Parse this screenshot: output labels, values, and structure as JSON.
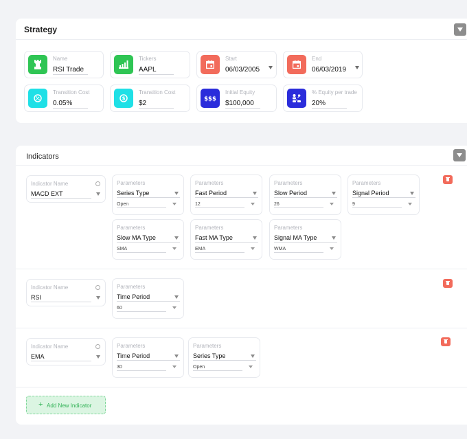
{
  "strategy": {
    "title": "Strategy",
    "cards": [
      {
        "label": "Name",
        "value": "RSI Trade",
        "icon": "rook-icon",
        "color": "#2fc554"
      },
      {
        "label": "Tickers",
        "value": "AAPL",
        "icon": "bar-chart-icon",
        "color": "#2fc554"
      },
      {
        "label": "Start",
        "value": "06/03/2005",
        "icon": "calendar-icon",
        "color": "#f26b5b"
      },
      {
        "label": "End",
        "value": "06/03/2019",
        "icon": "calendar-icon",
        "color": "#f26b5b"
      },
      {
        "label": "Transition Cost",
        "value": "0.05%",
        "icon": "percent-coin-icon",
        "color": "#1fe0e6"
      },
      {
        "label": "Transition Cost",
        "value": "$2",
        "icon": "dollar-coin-icon",
        "color": "#1fe0e6"
      },
      {
        "label": "Initial Equity",
        "value": "$100,000",
        "icon": "dollar-sign-icon",
        "color": "#2b2ddb"
      },
      {
        "label": "% Equity per trade",
        "value": "20%",
        "icon": "equity-split-icon",
        "color": "#2b2ddb"
      }
    ]
  },
  "indicators": {
    "title": "Indicators",
    "name_label": "Indicator Name",
    "parameters_label": "Parameters",
    "rows": [
      {
        "name": "MACD EXT",
        "params": [
          {
            "label": "Series Type",
            "value": "Open"
          },
          {
            "label": "Fast Period",
            "value": "12"
          },
          {
            "label": "Slow Period",
            "value": "26"
          },
          {
            "label": "Signal  Period",
            "value": "9"
          },
          {
            "label": "Slow MA Type",
            "value": "SMA"
          },
          {
            "label": "Fast MA Type",
            "value": "EMA"
          },
          {
            "label": "Signal MA Type",
            "value": "WMA"
          }
        ]
      },
      {
        "name": "RSI",
        "params": [
          {
            "label": "Time Period",
            "value": "60"
          }
        ]
      },
      {
        "name": "EMA",
        "params": [
          {
            "label": "Time Period",
            "value": "30"
          },
          {
            "label": "Series Type",
            "value": "Open"
          }
        ]
      }
    ],
    "add_label": "Add New Indicator"
  },
  "colors": {
    "green": "#2fc554",
    "red": "#f26b5b",
    "cyan": "#1fe0e6",
    "navy": "#2b2ddb",
    "add_button_bg": "#dbf5e2"
  }
}
